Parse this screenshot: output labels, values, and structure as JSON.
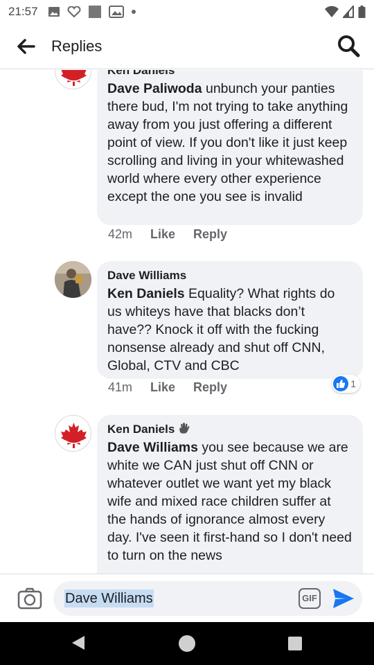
{
  "status_bar": {
    "time": "21:57"
  },
  "header": {
    "title": "Replies"
  },
  "comments": [
    {
      "author": "Ken Daniels",
      "tag": "Dave Paliwoda",
      "text": "unbunch your panties there bud, I'm not trying to take anything away from you just offering a different point of view. If you don't like it just keep scrolling and living in your whitewashed world where every other experience except the one you see is invalid",
      "time": "42m",
      "like_label": "Like",
      "reply_label": "Reply"
    },
    {
      "author": "Dave Williams",
      "tag": "Ken Daniels",
      "text": "Equality? What rights do us whiteys have that blacks don’t have?? Knock it off with the fucking nonsense already and shut off CNN, Global, CTV and CBC",
      "time": "41m",
      "like_label": "Like",
      "reply_label": "Reply",
      "reaction_count": "1"
    },
    {
      "author": "Ken Daniels",
      "tag": "Dave Williams",
      "text": "you see because we are white we CAN just shut off CNN or whatever outlet we want yet my black wife and mixed race children suffer at the hands of ignorance almost every day. I've seen it first-hand so I don't need to turn on the news"
    }
  ],
  "composer": {
    "value": "Dave Williams",
    "gif_label": "GIF"
  },
  "colors": {
    "accent": "#1877f2",
    "bubble": "#f0f2f5",
    "maple": "#d32027"
  },
  "icons": [
    "back-arrow-icon",
    "search-icon",
    "camera-icon",
    "gif-icon",
    "send-icon",
    "like-icon",
    "wave-icon",
    "maple-leaf-icon"
  ]
}
